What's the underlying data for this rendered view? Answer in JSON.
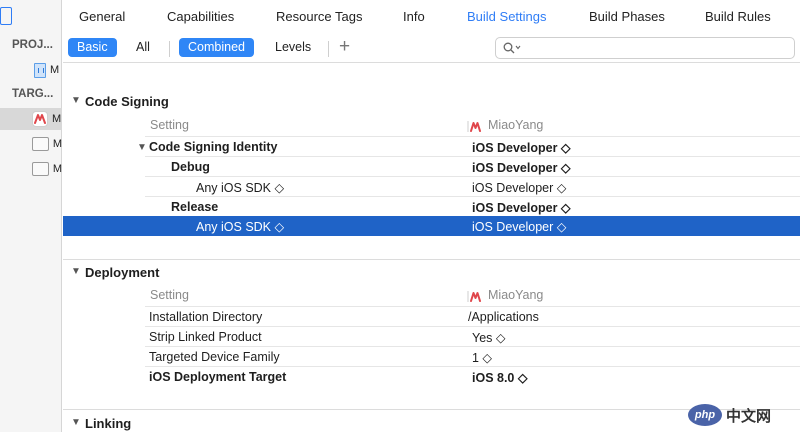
{
  "sidebar": {
    "project_header": "PROJ...",
    "targets_header": "TARG...",
    "project_items": [
      {
        "label": "M",
        "icon": "app-project-icon"
      }
    ],
    "target_items": [
      {
        "label": "M",
        "icon": "target-app-icon",
        "selected": true
      },
      {
        "label": "M",
        "icon": "target-box-icon",
        "selected": false
      },
      {
        "label": "M",
        "icon": "target-box-icon",
        "selected": false
      }
    ]
  },
  "tabs": [
    "General",
    "Capabilities",
    "Resource Tags",
    "Info",
    "Build Settings",
    "Build Phases",
    "Build Rules"
  ],
  "active_tab": "Build Settings",
  "filter": {
    "basic": "Basic",
    "all": "All",
    "combined": "Combined",
    "levels": "Levels",
    "add": "+",
    "search_placeholder": ""
  },
  "sections": {
    "code_signing": {
      "title": "Code Signing",
      "setting_header": "Setting",
      "target_header": "MiaoYang",
      "rows": [
        {
          "label": "Code Signing Identity",
          "value": "iOS Developer ◇"
        },
        {
          "label": "Debug",
          "value": "iOS Developer ◇"
        },
        {
          "label": "Any iOS SDK ◇",
          "value": "iOS Developer ◇"
        },
        {
          "label": "Release",
          "value": "iOS Developer ◇"
        },
        {
          "label": "Any iOS SDK ◇",
          "value": "iOS Developer ◇"
        }
      ]
    },
    "deployment": {
      "title": "Deployment",
      "setting_header": "Setting",
      "target_header": "MiaoYang",
      "rows": [
        {
          "label": "Installation Directory",
          "value": "/Applications"
        },
        {
          "label": "Strip Linked Product",
          "value": "Yes ◇"
        },
        {
          "label": "Targeted Device Family",
          "value": "1 ◇"
        },
        {
          "label": "iOS Deployment Target",
          "value": "iOS 8.0 ◇"
        }
      ]
    },
    "linking": {
      "title": "Linking"
    }
  },
  "watermark": {
    "logo": "php",
    "text": "中文网"
  },
  "colors": {
    "accent": "#2f7df6",
    "selection": "#1f63c7",
    "target_icon": "#e0474c"
  }
}
